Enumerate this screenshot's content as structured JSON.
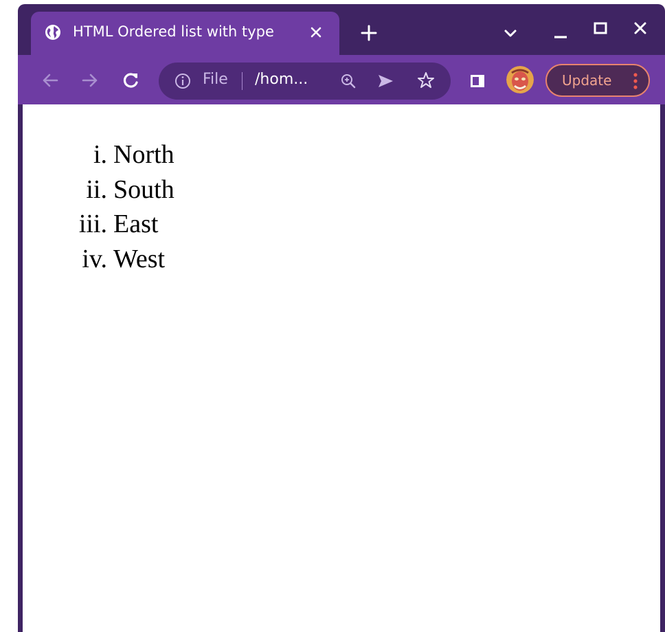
{
  "browser": {
    "tab": {
      "title": "HTML Ordered list with type",
      "favicon": "globe-icon"
    },
    "toolbar": {
      "omnibox": {
        "scheme_label": "File",
        "url": "/hom..."
      },
      "update_label": "Update"
    },
    "colors": {
      "frame": "#3f2463",
      "toolbar": "#6e3ca3",
      "omnibox": "#4e2a78",
      "update_border": "#e8836d",
      "update_text": "#f2a48f"
    }
  },
  "page": {
    "list": {
      "type": "i",
      "items": [
        {
          "marker": "i.",
          "label": "North"
        },
        {
          "marker": "ii.",
          "label": "South"
        },
        {
          "marker": "iii.",
          "label": "East"
        },
        {
          "marker": "iv.",
          "label": "West"
        }
      ]
    }
  }
}
